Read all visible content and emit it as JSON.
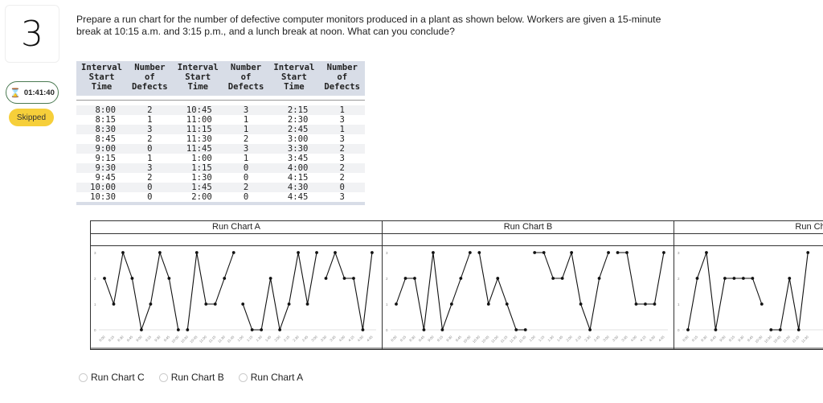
{
  "question": {
    "number": "3",
    "timer": "01:41:40",
    "status": "Skipped",
    "prompt": "Prepare a run chart for the number of defective computer monitors produced in a plant as shown below. Workers are given a 15-minute break at 10:15 a.m. and 3:15 p.m., and a lunch break at noon. What can you conclude?"
  },
  "table": {
    "headers": [
      "Interval\nStart\nTime",
      "Number\nof\nDefects",
      "Interval\nStart\nTime",
      "Number\nof\nDefects",
      "Interval\nStart\nTime",
      "Number\nof\nDefects"
    ],
    "rows": [
      [
        "8:00",
        "2",
        "10:45",
        "3",
        "2:15",
        "1"
      ],
      [
        "8:15",
        "1",
        "11:00",
        "1",
        "2:30",
        "3"
      ],
      [
        "8:30",
        "3",
        "11:15",
        "1",
        "2:45",
        "1"
      ],
      [
        "8:45",
        "2",
        "11:30",
        "2",
        "3:00",
        "3"
      ],
      [
        "9:00",
        "0",
        "11:45",
        "3",
        "3:30",
        "2"
      ],
      [
        "9:15",
        "1",
        "1:00",
        "1",
        "3:45",
        "3"
      ],
      [
        "9:30",
        "3",
        "1:15",
        "0",
        "4:00",
        "2"
      ],
      [
        "9:45",
        "2",
        "1:30",
        "0",
        "4:15",
        "2"
      ],
      [
        "10:00",
        "0",
        "1:45",
        "2",
        "4:30",
        "0"
      ],
      [
        "10:30",
        "0",
        "2:00",
        "0",
        "4:45",
        "3"
      ]
    ]
  },
  "chart_data": [
    {
      "type": "line",
      "title": "Run Chart A",
      "x": [
        "8:00",
        "8:15",
        "8:30",
        "8:45",
        "9:00",
        "9:15",
        "9:30",
        "9:45",
        "10:00",
        "10:30",
        "10:45",
        "11:00",
        "11:15",
        "11:30",
        "11:45",
        "1:00",
        "1:15",
        "1:30",
        "1:45",
        "2:00",
        "2:15",
        "2:30",
        "2:45",
        "3:00",
        "3:30",
        "3:45",
        "4:00",
        "4:15",
        "4:30",
        "4:45"
      ],
      "segments": [
        [
          0,
          8
        ],
        [
          9,
          14
        ],
        [
          15,
          23
        ],
        [
          24,
          29
        ]
      ],
      "values": [
        2,
        1,
        3,
        2,
        0,
        1,
        3,
        2,
        0,
        0,
        3,
        1,
        1,
        2,
        3,
        1,
        0,
        0,
        2,
        0,
        1,
        3,
        1,
        3,
        2,
        3,
        2,
        2,
        0,
        3
      ],
      "ylim": [
        0,
        3
      ],
      "yticks": [
        "0",
        "1",
        "2",
        "3"
      ],
      "xlabel": "",
      "ylabel": ""
    },
    {
      "type": "line",
      "title": "Run Chart B",
      "x": [
        "8:00",
        "8:15",
        "8:30",
        "8:45",
        "9:00",
        "9:15",
        "9:30",
        "9:45",
        "10:00",
        "10:30",
        "10:45",
        "11:00",
        "11:15",
        "11:30",
        "11:45",
        "1:00",
        "1:15",
        "1:30",
        "1:45",
        "2:00",
        "2:15",
        "2:30",
        "2:45",
        "3:00",
        "3:30",
        "3:45",
        "4:00",
        "4:15",
        "4:30",
        "4:45"
      ],
      "segments": [
        [
          0,
          8
        ],
        [
          9,
          14
        ],
        [
          15,
          23
        ],
        [
          24,
          29
        ]
      ],
      "values": [
        1,
        2,
        2,
        0,
        3,
        0,
        1,
        2,
        3,
        3,
        1,
        2,
        1,
        0,
        0,
        3,
        3,
        2,
        2,
        3,
        1,
        0,
        2,
        3,
        3,
        3,
        1,
        1,
        1,
        3
      ],
      "ylim": [
        0,
        3
      ],
      "yticks": [
        "0",
        "1",
        "2",
        "3"
      ],
      "xlabel": "",
      "ylabel": ""
    },
    {
      "type": "line",
      "title": "Run Chart C",
      "x": [
        "8:00",
        "8:15",
        "8:30",
        "8:45",
        "9:00",
        "9:15",
        "9:30",
        "9:45",
        "10:00",
        "10:30",
        "10:45",
        "11:00",
        "11:15",
        "11:30"
      ],
      "segments": [
        [
          0,
          8
        ],
        [
          9,
          13
        ]
      ],
      "values": [
        0,
        2,
        3,
        0,
        2,
        2,
        2,
        2,
        1,
        0,
        0,
        2,
        0,
        3
      ],
      "ylim": [
        0,
        3
      ],
      "yticks": [
        "0",
        "1",
        "2",
        "3"
      ],
      "xlabel": "",
      "ylabel": ""
    }
  ],
  "options": [
    {
      "label": "Run Chart C"
    },
    {
      "label": "Run Chart B"
    },
    {
      "label": "Run Chart A"
    }
  ]
}
